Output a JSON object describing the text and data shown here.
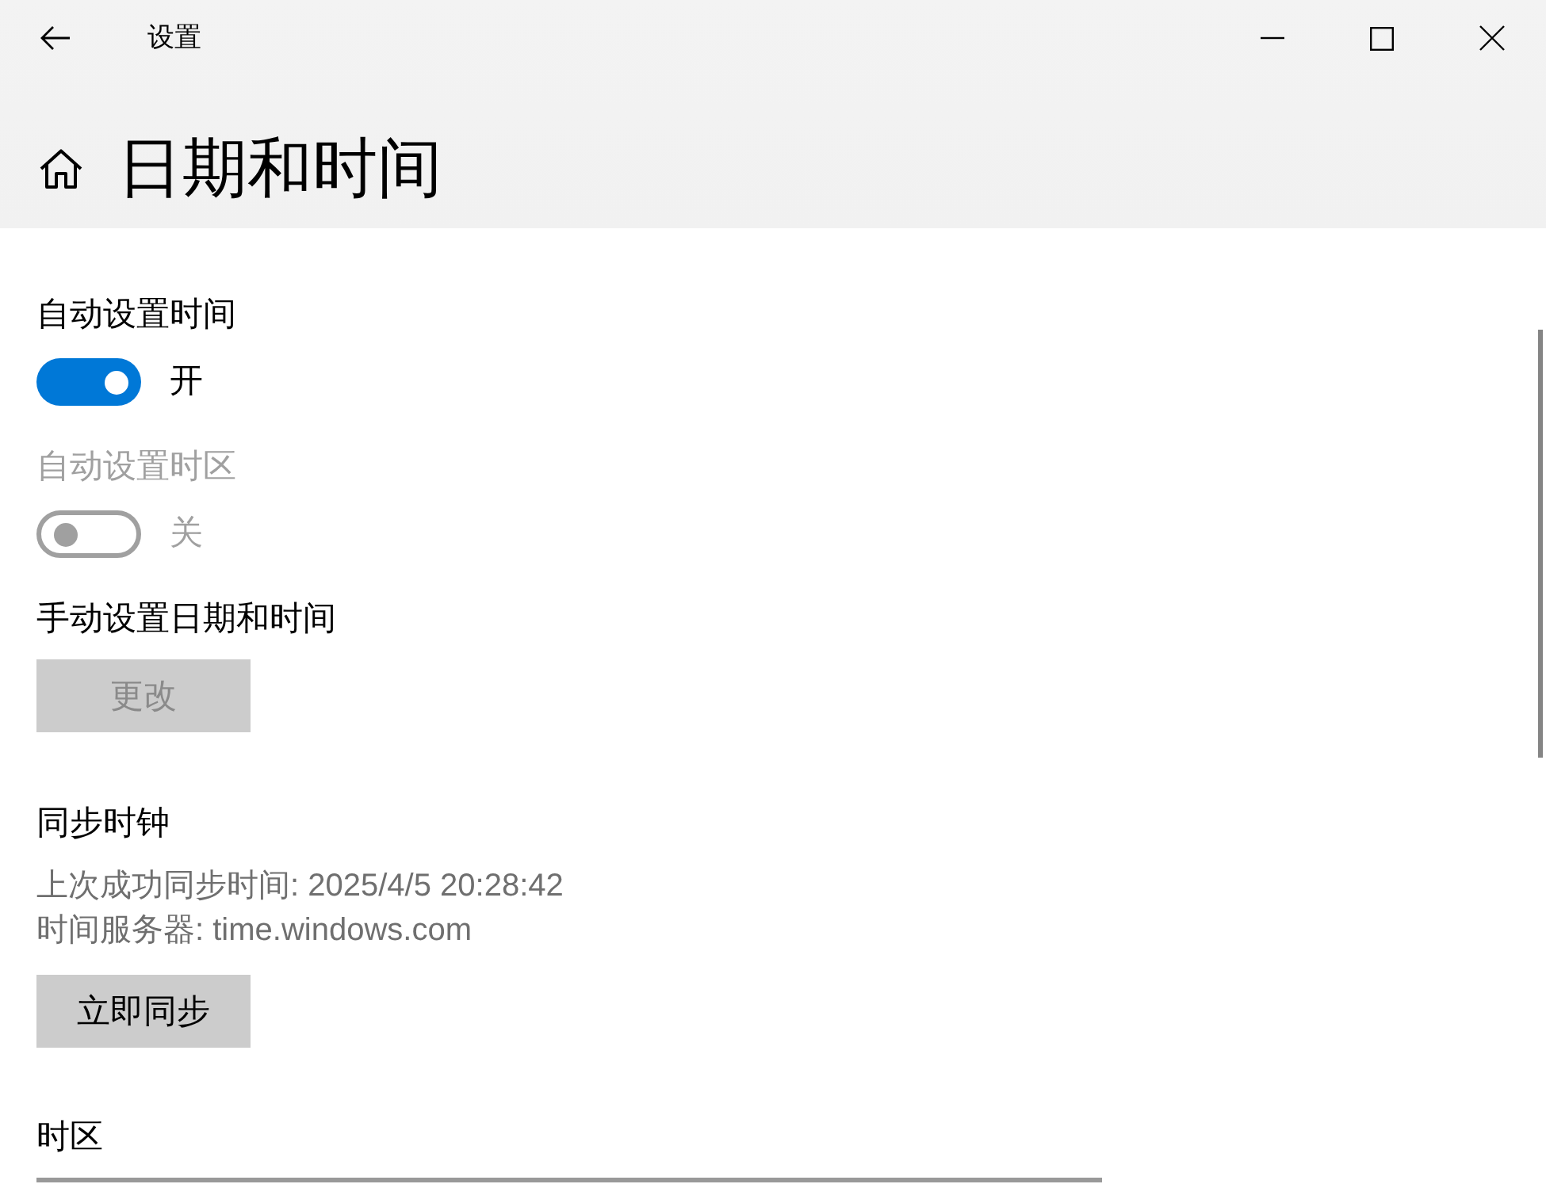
{
  "window": {
    "title": "设置"
  },
  "header": {
    "title": "日期和时间"
  },
  "sections": [
    {
      "kind": "toggle",
      "label": "自动设置时间",
      "on": true,
      "disabled": false,
      "state_text": "开"
    },
    {
      "kind": "toggle",
      "label": "自动设置时区",
      "on": false,
      "disabled": true,
      "state_text": "关"
    },
    {
      "kind": "button",
      "label": "手动设置日期和时间",
      "button": "更改",
      "disabled": true
    },
    {
      "kind": "sync",
      "label": "同步时钟",
      "lines": [
        "上次成功同步时间: 2025/4/5 20:28:42",
        "时间服务器: time.windows.com"
      ],
      "button": "立即同步",
      "disabled": false
    },
    {
      "kind": "dropdown",
      "label": "时区"
    }
  ]
}
